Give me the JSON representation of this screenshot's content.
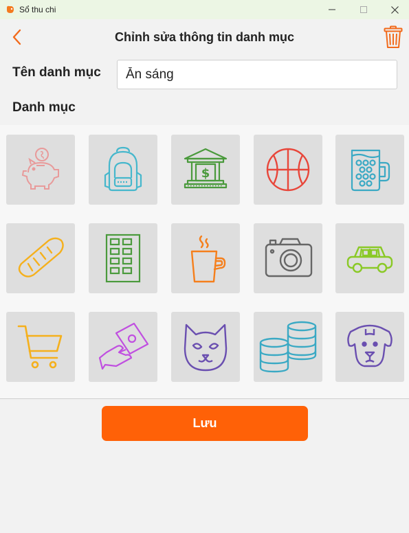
{
  "window": {
    "title": "Sổ thu chi",
    "app_icon": "app-logo-icon",
    "controls": [
      "minimize-icon",
      "maximize-icon",
      "close-icon"
    ]
  },
  "header": {
    "back_icon": "chevron-left-icon",
    "title": "Chỉnh sửa thông tin danh mục",
    "delete_icon": "trash-icon"
  },
  "form": {
    "name_label": "Tên danh mục",
    "name_value": "Ăn sáng",
    "category_label": "Danh mục"
  },
  "icons": [
    {
      "name": "piggy-bank-icon",
      "color": "#e89a9a"
    },
    {
      "name": "backpack-icon",
      "color": "#45b7cc"
    },
    {
      "name": "bank-icon",
      "color": "#4a9a3c"
    },
    {
      "name": "basketball-icon",
      "color": "#e8463a"
    },
    {
      "name": "beer-mug-icon",
      "color": "#3aa9c4"
    },
    {
      "name": "bread-icon",
      "color": "#f5b01c"
    },
    {
      "name": "building-icon",
      "color": "#4a9a3c"
    },
    {
      "name": "coffee-cup-icon",
      "color": "#f57f1c"
    },
    {
      "name": "camera-icon",
      "color": "#666666"
    },
    {
      "name": "car-icon",
      "color": "#8ac926"
    },
    {
      "name": "shopping-cart-icon",
      "color": "#f5b01c"
    },
    {
      "name": "money-hand-icon",
      "color": "#c04fe0"
    },
    {
      "name": "cat-icon",
      "color": "#6a4fb0"
    },
    {
      "name": "coins-icon",
      "color": "#3aa9c4"
    },
    {
      "name": "dog-icon",
      "color": "#6a4fb0"
    }
  ],
  "actions": {
    "save_label": "Lưu"
  },
  "colors": {
    "accent": "#ff6107",
    "titlebar": "#ecf6e4",
    "tile": "#dedede",
    "background": "#f2f2f2"
  }
}
